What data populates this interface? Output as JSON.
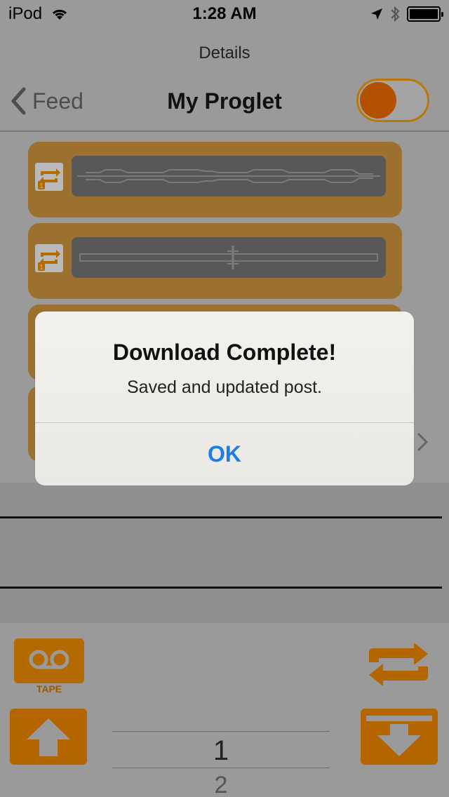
{
  "status_bar": {
    "carrier": "iPod",
    "time": "1:28 AM"
  },
  "header": {
    "section_label": "Details",
    "back_label": "Feed",
    "title": "My Proglet",
    "toggle_on": true
  },
  "cards": {
    "count_visible": 4
  },
  "toolbar": {
    "tape_label": "TAPE",
    "picker_values": [
      "1",
      "2"
    ]
  },
  "alert": {
    "title": "Download Complete!",
    "message": "Saved and updated post.",
    "ok_label": "OK",
    "ok_color": "#1a7fe6"
  },
  "colors": {
    "accent_orange": "#b56500",
    "card_brown": "#9c7130"
  }
}
